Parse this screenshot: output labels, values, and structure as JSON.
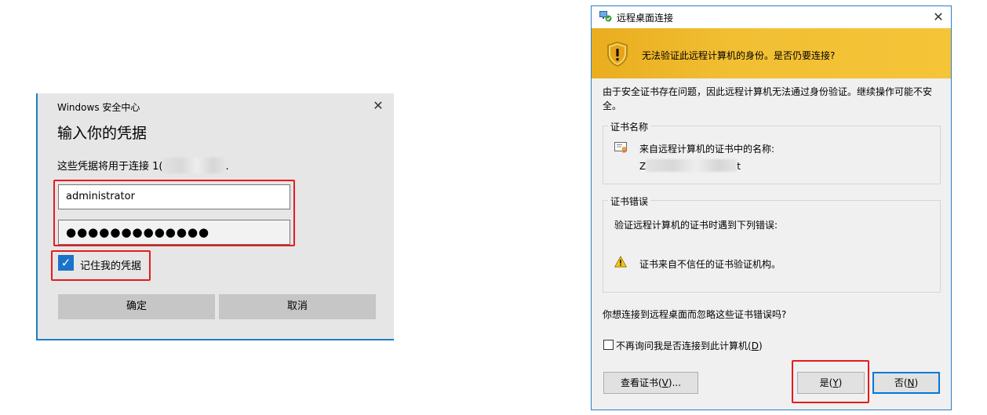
{
  "windows_security": {
    "title": "Windows 安全中心",
    "close_label": "✕",
    "heading": "输入你的凭据",
    "description_prefix": "这些凭据将用于连接 1(",
    "description_suffix": ".",
    "username_value": "administrator",
    "password_mask": "●●●●●●●●●●●●●",
    "remember_label": "记住我的凭据",
    "remember_checked": true,
    "ok_label": "确定",
    "cancel_label": "取消",
    "accent_color": "#1a73c9"
  },
  "remote_desktop": {
    "title": "远程桌面连接",
    "close_label": "✕",
    "banner_text": "无法验证此远程计算机的身份。是否仍要连接?",
    "warning_text": "由于安全证书存在问题，因此远程计算机无法通过身份验证。继续操作可能不安全。",
    "cert_name_group": {
      "label": "证书名称",
      "name_label": "来自远程计算机的证书中的名称:",
      "name_prefix": "Z",
      "name_suffix": "t"
    },
    "cert_error_group": {
      "label": "证书错误",
      "description": "验证远程计算机的证书时遇到下列错误:",
      "error_item": "证书来自不信任的证书验证机构。"
    },
    "question": "你想连接到远程桌面而忽略这些证书错误吗?",
    "dont_ask": {
      "label_prefix": "不再询问我是否连接到此计算机(",
      "label_key": "D",
      "label_suffix": ")",
      "checked": false
    },
    "view_cert_button": {
      "prefix": "查看证书(",
      "key": "V",
      "suffix": ")..."
    },
    "yes_button": {
      "prefix": "是(",
      "key": "Y",
      "suffix": ")"
    },
    "no_button": {
      "prefix": "否(",
      "key": "N",
      "suffix": ")"
    },
    "banner_color": "#f2bf33"
  },
  "highlight_color": "#e51c1c"
}
